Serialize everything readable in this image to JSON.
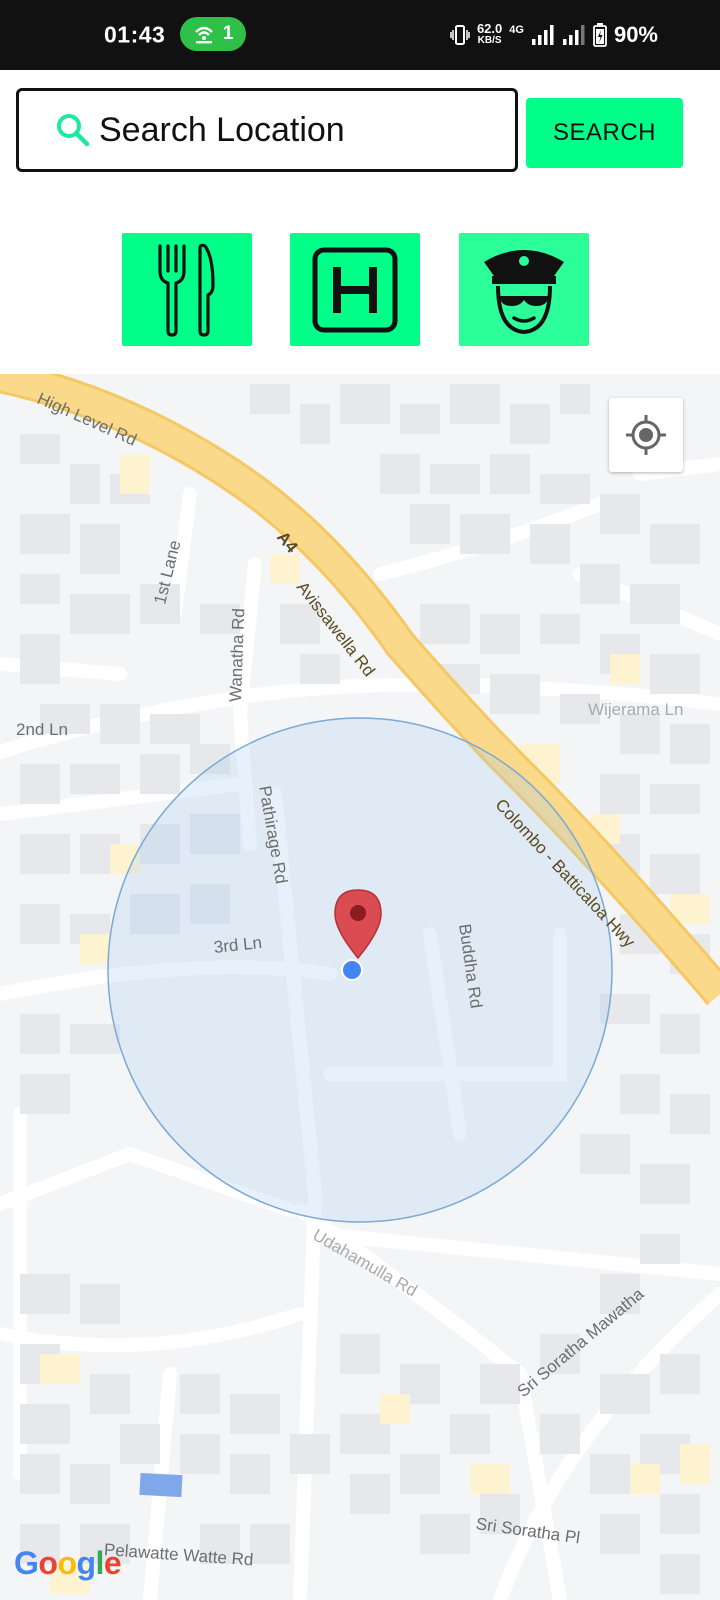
{
  "status_bar": {
    "time": "01:43",
    "hotspot_count": "1",
    "speed_value": "62.0",
    "speed_unit": "KB/S",
    "network_type": "4G",
    "battery": "90%"
  },
  "search": {
    "placeholder": "Search Location",
    "button_label": "SEARCH"
  },
  "categories": [
    {
      "name": "restaurant",
      "icon": "fork-knife-icon"
    },
    {
      "name": "hospital",
      "icon": "hospital-h-icon"
    },
    {
      "name": "police",
      "icon": "police-officer-icon"
    }
  ],
  "map": {
    "labels": {
      "high_level_rd": "High Level Rd",
      "first_lane": "1st Lane",
      "wanatha_rd": "Wanatha Rd",
      "avissawella_rd": "Avissawella Rd",
      "a4": "A4",
      "second_ln": "2nd Ln",
      "wijerama_ln": "Wijerama Ln",
      "pathirage_rd": "Pathirage Rd",
      "colombo_hwy": "Colombo - Batticaloa Hwy",
      "third_ln": "3rd Ln",
      "buddha_rd": "Buddha Rd",
      "sri_soratha_mw": "Sri Soratha Mawatha",
      "sri_soratha_pl": "Sri Soratha Pl",
      "udahamulla_rd": "Udahamulla Rd",
      "watte_rd": "Pelawatte Watte Rd"
    },
    "attribution": "Google",
    "colors": {
      "highway": "#fbd98a",
      "accuracy_circle": "#a8cdf0",
      "marker": "#db4b52",
      "user_dot": "#4285f4"
    }
  }
}
